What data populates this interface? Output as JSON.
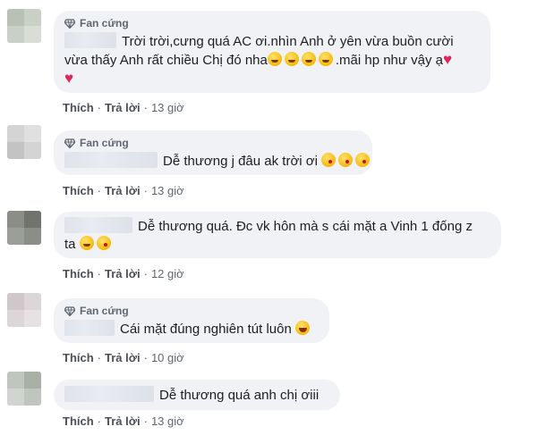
{
  "badge_label": "Fan cứng",
  "actions": {
    "like": "Thích",
    "reply": "Trả lời",
    "separator": "·"
  },
  "comments": [
    {
      "badge": true,
      "text_line1": "Trời trời,cưng quá AC ơi.nhìn Anh ở yên vừa buồn cười",
      "text_line2": "vừa thấy Anh rất chiều Chị đó nha",
      "text_line2_tail": ".mãi hp như vậy ạ",
      "time": "13 giờ"
    },
    {
      "badge": true,
      "text_line1": "Dễ thương j đâu ak trời ơi",
      "time": "13 giờ"
    },
    {
      "badge": false,
      "text_line1": "Dễ thương quá. Đc vk hôn mà s cái mặt a Vinh 1 đống z",
      "text_line2": "ta",
      "time": "12 giờ"
    },
    {
      "badge": true,
      "text_line1": "Cái mặt đúng nghiên tút luôn",
      "time": "10 giờ"
    },
    {
      "badge": false,
      "text_line1": "Dễ thương quá anh chị ơiii",
      "time": "13 giờ"
    }
  ],
  "emoji_icons": [
    "grinning-face-emoji",
    "face-blowing-kiss-emoji",
    "tears-of-joy-emoji",
    "red-heart-emoji"
  ]
}
